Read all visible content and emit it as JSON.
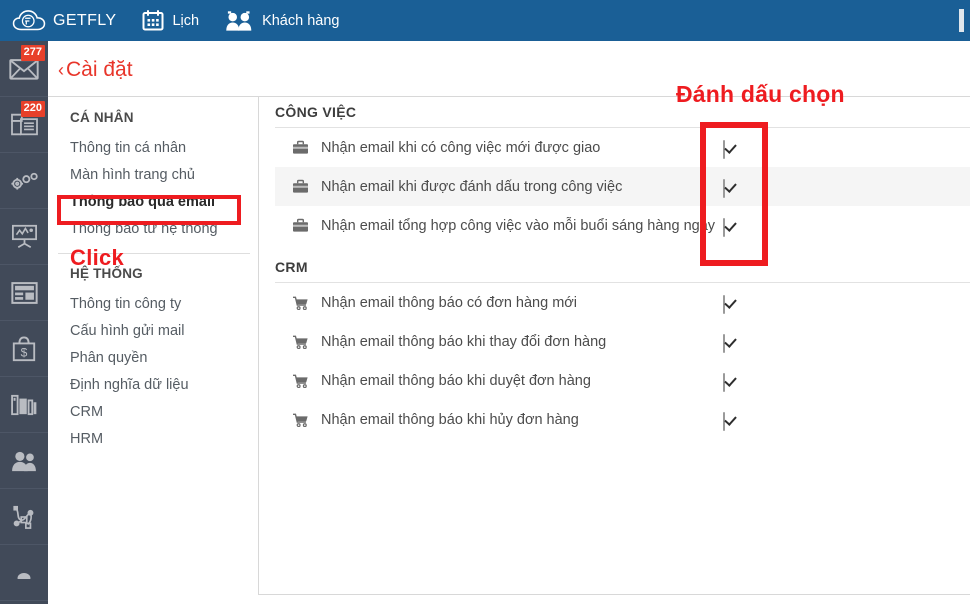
{
  "header": {
    "brand": "GETFLY",
    "brand_icon": "cloud-logo-icon",
    "nav": [
      {
        "label": "Lịch",
        "icon": "calendar-icon"
      },
      {
        "label": "Khách hàng",
        "icon": "people-icon"
      }
    ]
  },
  "rail": {
    "items": [
      {
        "icon": "envelope-icon",
        "badge": "277"
      },
      {
        "icon": "document-note-icon",
        "badge": "220"
      },
      {
        "icon": "gears-icon",
        "badge": ""
      },
      {
        "icon": "chart-board-icon",
        "badge": ""
      },
      {
        "icon": "newspaper-icon",
        "badge": ""
      },
      {
        "icon": "shopping-bag-dollar-icon",
        "badge": ""
      },
      {
        "icon": "books-icon",
        "badge": ""
      },
      {
        "icon": "users-icon",
        "badge": ""
      },
      {
        "icon": "network-nodes-icon",
        "badge": ""
      },
      {
        "icon": "partial-icon",
        "badge": ""
      }
    ]
  },
  "page": {
    "back_chevron": "‹",
    "title": "Cài đặt"
  },
  "menu": {
    "group_personal": "CÁ NHÂN",
    "personal_items": [
      "Thông tin cá nhân",
      "Màn hình trang chủ",
      "Thông báo qua email",
      "Thông báo từ hệ thống"
    ],
    "active_index": 2,
    "group_system": "HỆ THỐNG",
    "system_items": [
      "Thông tin công ty",
      "Cấu hình gửi mail",
      "Phân quyền",
      "Định nghĩa dữ liệu",
      "CRM",
      "HRM"
    ]
  },
  "content": {
    "sections": [
      {
        "title": "CÔNG VIỆC",
        "row_icon": "briefcase-icon",
        "rows": [
          {
            "label": "Nhận email khi có công việc mới được giao",
            "checked": true,
            "alt": false
          },
          {
            "label": "Nhận email khi được đánh dấu trong công việc",
            "checked": true,
            "alt": true
          },
          {
            "label": "Nhận email tổng hợp công việc vào mỗi buổi sáng hàng ngày",
            "checked": true,
            "alt": false
          }
        ]
      },
      {
        "title": "CRM",
        "row_icon": "shopping-cart-icon",
        "rows": [
          {
            "label": "Nhận email thông báo có đơn hàng mới",
            "checked": true,
            "alt": false
          },
          {
            "label": "Nhận email thông báo khi thay đổi đơn hàng",
            "checked": true,
            "alt": false
          },
          {
            "label": "Nhận email thông báo khi duyệt đơn hàng",
            "checked": true,
            "alt": false
          },
          {
            "label": "Nhận email thông báo khi hủy đơn hàng",
            "checked": true,
            "alt": false
          }
        ]
      }
    ]
  },
  "annotations": {
    "click_label": "Click",
    "check_label": "Đánh dấu chọn",
    "color": "#ee1c20"
  },
  "colors": {
    "header_blue": "#1a5f96",
    "rail_dark": "#414a59",
    "badge_red": "#e8402a",
    "title_red": "#e8352a",
    "annotation_red": "#ee1c20"
  }
}
